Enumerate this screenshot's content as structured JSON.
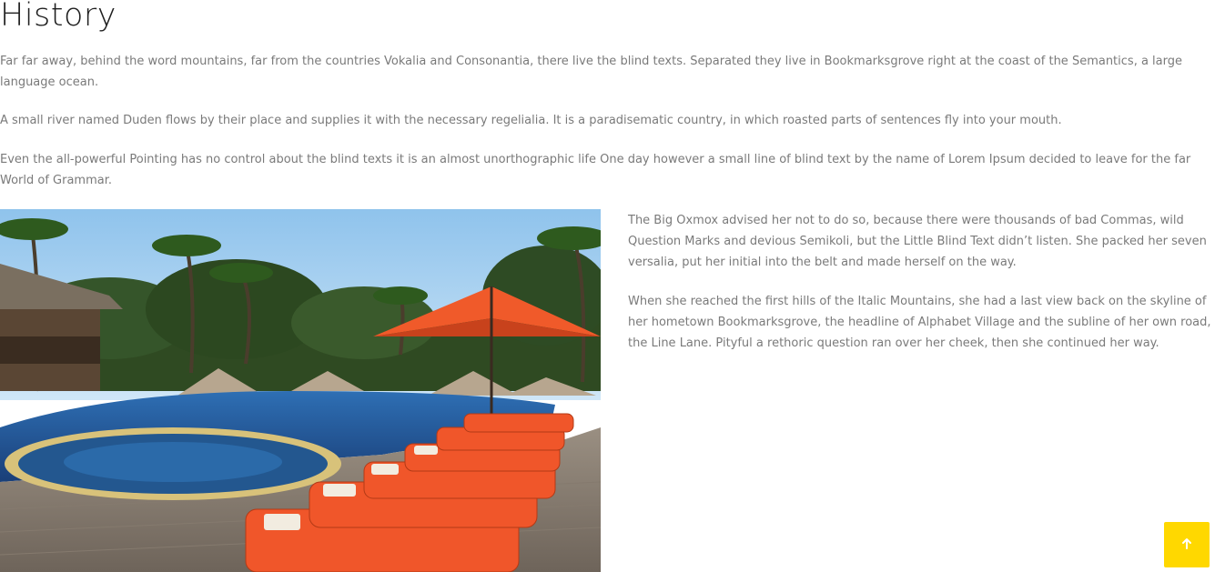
{
  "section": {
    "title": "History",
    "paragraphs": [
      "Far far away, behind the word mountains, far from the countries Vokalia and Consonantia, there live the blind texts. Separated they live in Bookmarksgrove right at the coast of the Semantics, a large language ocean.",
      "A small river named Duden flows by their place and supplies it with the necessary regelialia. It is a paradisematic country, in which roasted parts of sentences fly into your mouth.",
      "Even the all-powerful Pointing has no control about the blind texts it is an almost unorthographic life One day however a small line of blind text by the name of Lorem Ipsum decided to leave for the far World of Grammar."
    ],
    "side_paragraphs": [
      "The Big Oxmox advised her not to do so, because there were thousands of bad Commas, wild Question Marks and devious Semikoli, but the Little Blind Text didn’t listen. She packed her seven versalia, put her initial into the belt and made herself on the way.",
      "When she reached the first hills of the Italic Mountains, she had a last view back on the skyline of her hometown Bookmarksgrove, the headline of Alphabet Village and the subline of her own road, the Line Lane. Pityful a rethoric question ran over her cheek, then she continued her way."
    ]
  },
  "back_to_top": {
    "icon": "arrow-up-icon",
    "color": "#ffd800"
  }
}
